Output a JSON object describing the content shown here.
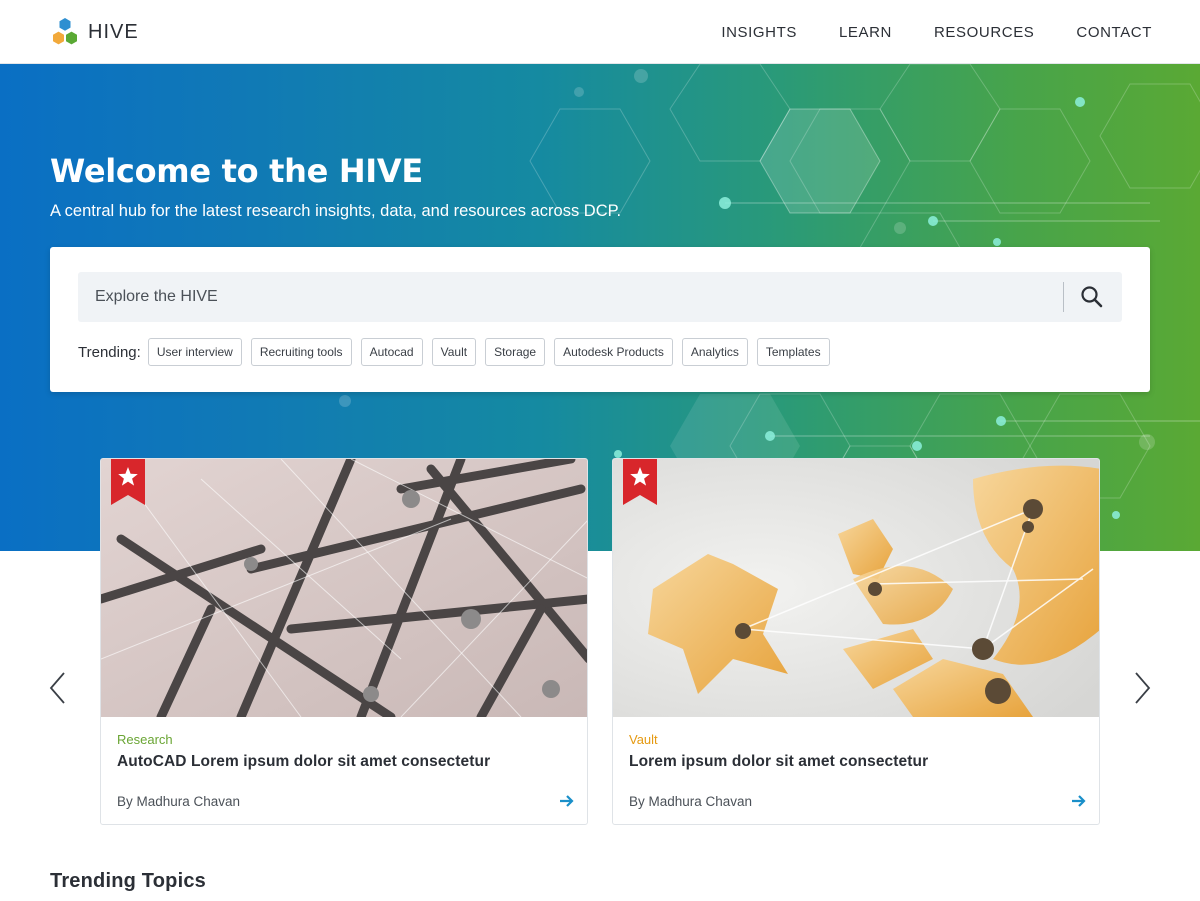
{
  "header": {
    "logo_text": "HIVE",
    "logo_colors": [
      "#2e8fd1",
      "#f2a93b",
      "#5aa934"
    ],
    "nav": [
      {
        "label": "INSIGHTS"
      },
      {
        "label": "LEARN"
      },
      {
        "label": "RESOURCES"
      },
      {
        "label": "CONTACT"
      }
    ]
  },
  "hero": {
    "title": "Welcome to the HIVE",
    "subtitle": "A central hub for the latest research insights, data, and resources across DCP.",
    "gradient_colors": [
      "#0a6fc4",
      "#5aa934"
    ]
  },
  "search": {
    "placeholder": "Explore the HIVE",
    "button_icon": "search-icon",
    "trending_label": "Trending:",
    "trending_tags": [
      "User interview",
      "Recruiting tools",
      "Autocad",
      "Vault",
      "Storage",
      "Autodesk Products",
      "Analytics",
      "Templates"
    ]
  },
  "carousel": {
    "prev_icon": "chevron-left-icon",
    "next_icon": "chevron-right-icon",
    "cards": [
      {
        "category": "Research",
        "category_color": "#6aa534",
        "title": "AutoCAD Lorem ipsum dolor sit amet consectetur",
        "author": "By Madhura Chavan",
        "badge_icon": "star-bookmark-icon",
        "image": "metal-rod-structure-photo"
      },
      {
        "category": "Vault",
        "category_color": "#e59a12",
        "title": "Lorem ipsum dolor sit amet consectetur",
        "author": "By Madhura Chavan",
        "badge_icon": "star-bookmark-icon",
        "image": "orange-canopy-sculpture-photo"
      }
    ],
    "arrow_color": "#1a8fc9",
    "badge_color": "#d8262b"
  },
  "sections": {
    "trending_topics_title": "Trending Topics"
  }
}
